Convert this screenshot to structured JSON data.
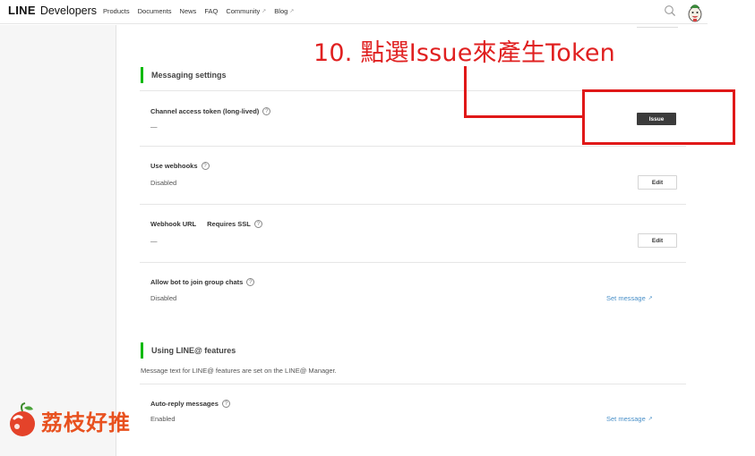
{
  "header": {
    "brand_line": "LINE",
    "brand_dev": "Developers",
    "nav": [
      {
        "label": "Products",
        "external": false
      },
      {
        "label": "Documents",
        "external": false
      },
      {
        "label": "News",
        "external": false
      },
      {
        "label": "FAQ",
        "external": false
      },
      {
        "label": "Community",
        "external": true
      },
      {
        "label": "Blog",
        "external": true
      }
    ],
    "search_icon": "search-icon",
    "avatar_icon": "user-avatar"
  },
  "messaging": {
    "title": "Messaging settings",
    "token": {
      "label": "Channel access token (long-lived)",
      "value": "—",
      "button": "Issue"
    },
    "webhooks": {
      "label": "Use webhooks",
      "value": "Disabled",
      "button": "Edit"
    },
    "webhook_url": {
      "label": "Webhook URL",
      "sub_label": "Requires SSL",
      "value": "—",
      "button": "Edit"
    },
    "group_chats": {
      "label": "Allow bot to join group chats",
      "value": "Disabled",
      "link": "Set message"
    }
  },
  "line_at": {
    "title": "Using LINE@ features",
    "description": "Message text for LINE@ features are set on the LINE@ Manager.",
    "auto_reply": {
      "label": "Auto-reply messages",
      "value": "Enabled",
      "link": "Set message"
    }
  },
  "help_glyph": "?",
  "external_glyph": "↗",
  "annotation": {
    "text": "10. 點選Issue來產生Token",
    "color": "#e02020"
  },
  "watermark": {
    "text": "荔枝好推",
    "color": "#e8511f"
  },
  "colors": {
    "accent_green": "#00b900",
    "link_blue": "#4a90c8",
    "dark_button": "#3b3b3b"
  }
}
